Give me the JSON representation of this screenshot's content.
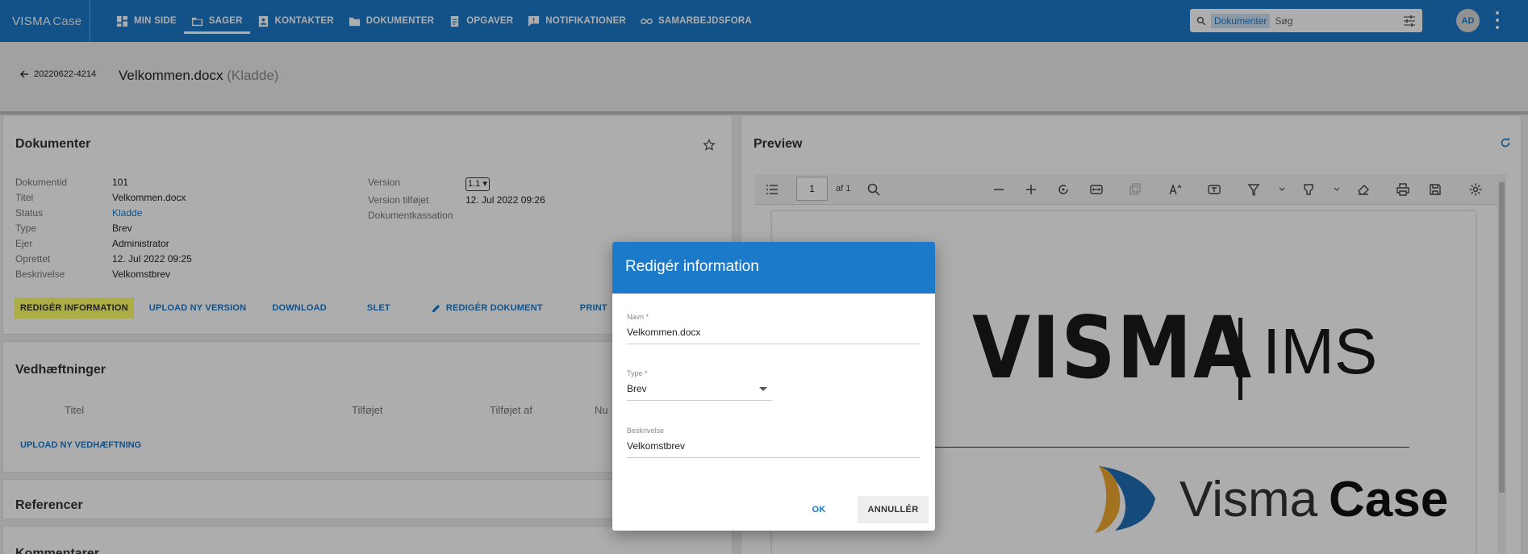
{
  "app": {
    "brand": "VISMA",
    "brand_sub": "Case"
  },
  "nav": [
    {
      "label": "MIN SIDE",
      "icon": "dashboard-icon"
    },
    {
      "label": "SAGER",
      "icon": "folder-icon",
      "active": true
    },
    {
      "label": "KONTAKTER",
      "icon": "contact-card-icon"
    },
    {
      "label": "DOKUMENTER",
      "icon": "document-folder-icon"
    },
    {
      "label": "OPGAVER",
      "icon": "task-icon"
    },
    {
      "label": "NOTIFIKATIONER",
      "icon": "notification-icon"
    },
    {
      "label": "SAMARBEJDSFORA",
      "icon": "infinity-icon"
    }
  ],
  "search": {
    "scope": "Dokumenter",
    "placeholder": "Søg"
  },
  "user": {
    "initials": "AD"
  },
  "header": {
    "case_id": "20220622-4214",
    "title": "Velkommen.docx",
    "status": "(Kladde)"
  },
  "documents": {
    "heading": "Dokumenter",
    "fields_left": [
      {
        "key": "Dokumentid",
        "value": "101"
      },
      {
        "key": "Titel",
        "value": "Velkommen.docx"
      },
      {
        "key": "Status",
        "value": "Kladde",
        "link": true
      },
      {
        "key": "Type",
        "value": "Brev"
      },
      {
        "key": "Ejer",
        "value": "Administrator"
      },
      {
        "key": "Oprettet",
        "value": "12. Jul 2022 09:25"
      },
      {
        "key": "Beskrivelse",
        "value": "Velkomstbrev"
      }
    ],
    "fields_right": [
      {
        "key": "Version",
        "value": "1.1"
      },
      {
        "key": "Version tilføjet",
        "value": "12. Jul 2022 09:26"
      },
      {
        "key": "Dokumentkassation",
        "value": ""
      }
    ],
    "actions": [
      "REDIGÉR INFORMATION",
      "UPLOAD NY VERSION",
      "DOWNLOAD",
      "SLET",
      "REDIGÉR DOKUMENT",
      "PRINT"
    ]
  },
  "attachments": {
    "heading": "Vedhæftninger",
    "columns": [
      "Titel",
      "Tilføjet",
      "Tilføjet af",
      "Nu"
    ],
    "upload_label": "UPLOAD NY VEDHÆFTNING"
  },
  "references": {
    "heading": "Referencer"
  },
  "comments": {
    "heading": "Kommentarer"
  },
  "preview": {
    "heading": "Preview",
    "page_current": "1",
    "page_total_label": "af 1",
    "logo_main": "VISMA",
    "logo_sub": "IMS",
    "product_word1": "Visma",
    "product_word2": "Case"
  },
  "dialog": {
    "title": "Redigér information",
    "name_label": "Navn *",
    "name_value": "Velkommen.docx",
    "type_label": "Type *",
    "type_value": "Brev",
    "desc_label": "Beskrivelse",
    "desc_value": "Velkomstbrev",
    "ok_label": "OK",
    "cancel_label": "ANNULLÉR"
  },
  "colors": {
    "brand": "#1b7ac9",
    "highlight": "#ffff66",
    "visma_red": "#d61d57"
  }
}
